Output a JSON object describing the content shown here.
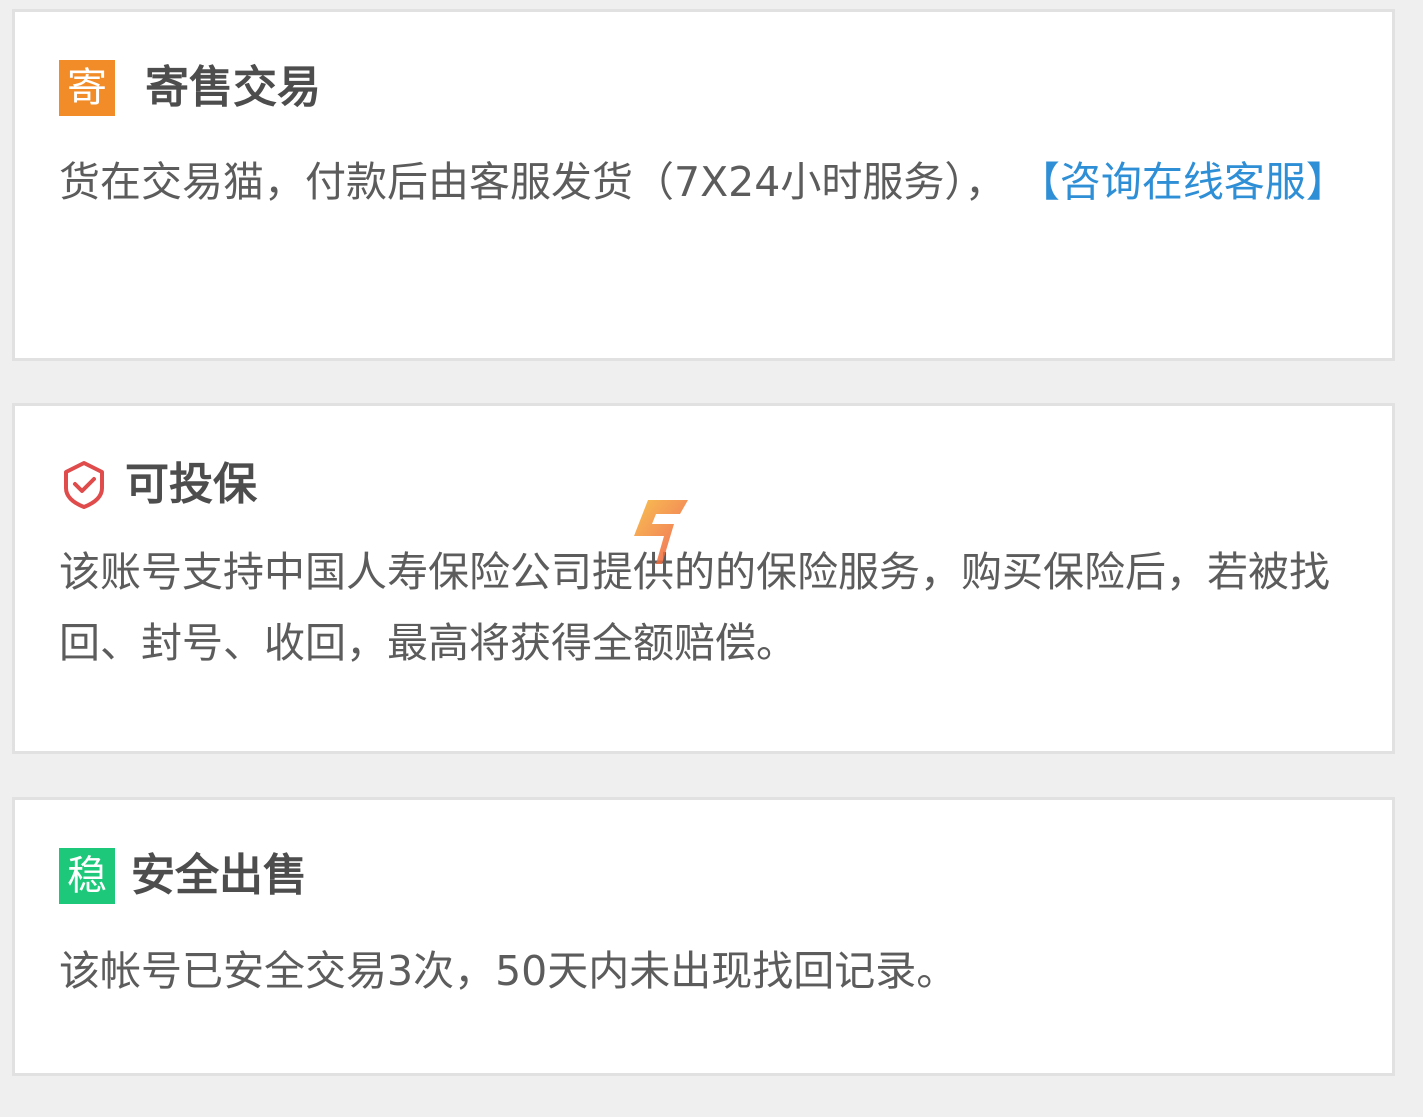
{
  "cards": {
    "consign": {
      "badge_text": "寄",
      "title": "寄售交易",
      "description": "货在交易猫，付款后由客服发货（7X24小时服务），",
      "link_label": "【咨询在线客服】",
      "badge_color": "#f28c28",
      "link_color": "#2f8fd6"
    },
    "insure": {
      "icon": "shield-check-icon",
      "title": "可投保",
      "description": "该账号支持中国人寿保险公司提供的的保险服务，购买保险后，若被找回、封号、收回，最高将获得全额赔偿。",
      "icon_color": "#e04b4b"
    },
    "safe": {
      "badge_text": "稳",
      "title": "安全出售",
      "description": "该帐号已安全交易3次，50天内未出现找回记录。",
      "badge_color": "#1ec87a"
    }
  },
  "watermark": {
    "icon": "brand-logo-icon",
    "colors": [
      "#f7b733",
      "#ef4e3f"
    ]
  }
}
